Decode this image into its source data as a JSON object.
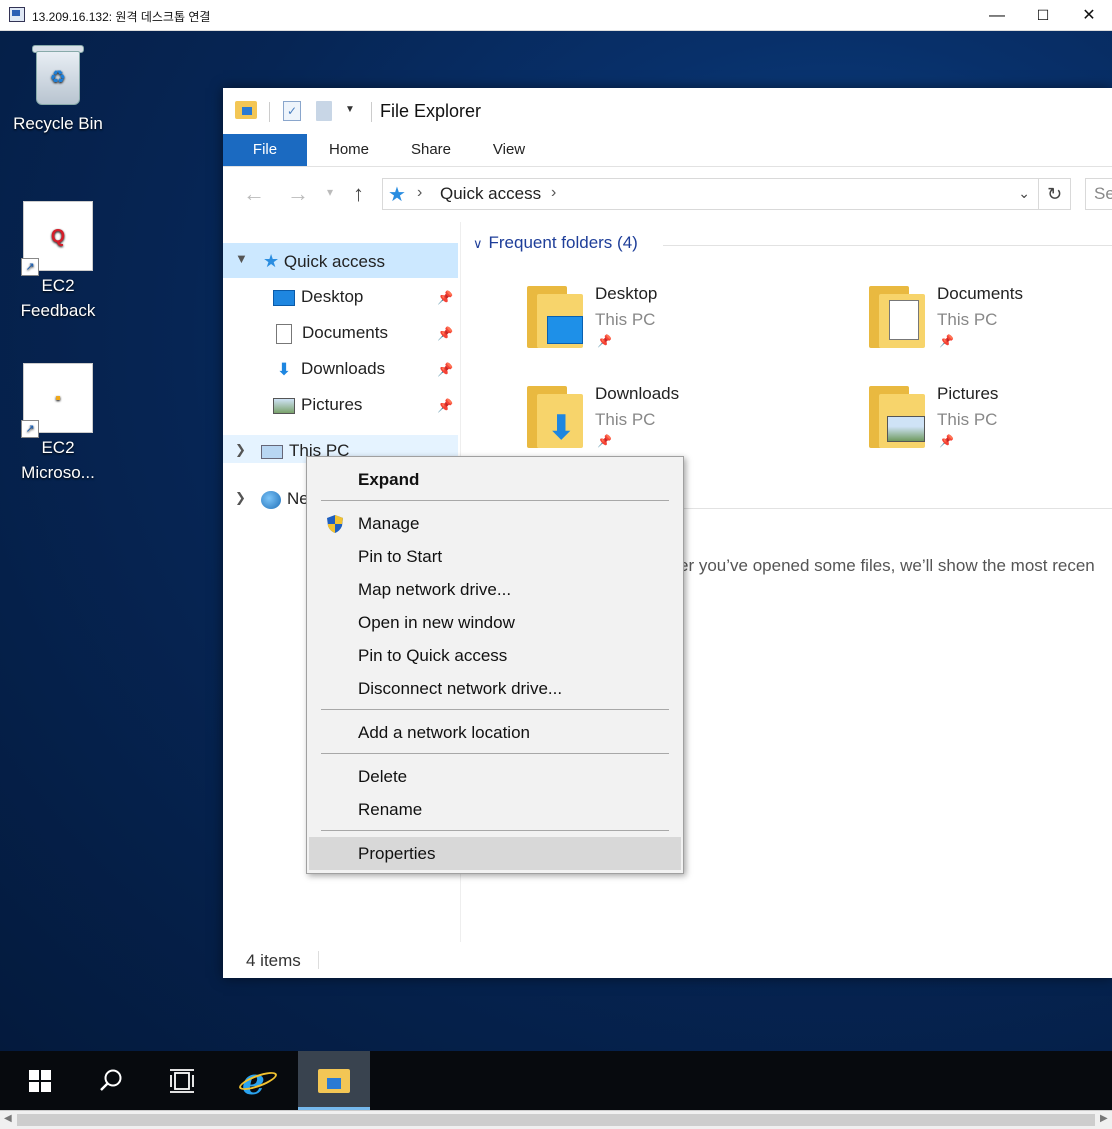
{
  "rdp": {
    "title": "13.209.16.132: 원격 데스크톱 연결",
    "min_glyph": "—",
    "max_glyph": "☐",
    "close_glyph": "✕"
  },
  "desktop": {
    "icons": [
      {
        "label": "Recycle Bin",
        "icon": "recycle-bin-icon"
      },
      {
        "label": "EC2\nFeedback",
        "line1": "EC2",
        "line2": "Feedback",
        "glyph": "Q",
        "icon": "ec2-feedback-icon"
      },
      {
        "label": "EC2 Microso...",
        "line1": "EC2",
        "line2": "Microso...",
        "glyph": "▪",
        "icon": "ec2-microsoft-icon"
      }
    ]
  },
  "explorer": {
    "title": "File Explorer",
    "ribbon_tabs": [
      "File",
      "Home",
      "Share",
      "View"
    ],
    "address": {
      "crumb": "Quick access",
      "search_placeholder": "Se"
    },
    "nav": {
      "quick_access": "Quick access",
      "items": [
        {
          "label": "Desktop",
          "icon": "desktop-icon"
        },
        {
          "label": "Documents",
          "icon": "documents-icon"
        },
        {
          "label": "Downloads",
          "icon": "downloads-icon"
        },
        {
          "label": "Pictures",
          "icon": "pictures-icon"
        }
      ],
      "this_pc": "This PC",
      "network": "Ne"
    },
    "frequent_header": "Frequent folders (4)",
    "folders": [
      {
        "name": "Desktop",
        "location": "This PC"
      },
      {
        "name": "Documents",
        "location": "This PC"
      },
      {
        "name": "Downloads",
        "location": "This PC"
      },
      {
        "name": "Pictures",
        "location": "This PC"
      }
    ],
    "recent_message": "er you’ve opened some files, we’ll show the most recen",
    "status": "4 items"
  },
  "context_menu": {
    "items": [
      "Expand",
      "Manage",
      "Pin to Start",
      "Map network drive...",
      "Open in new window",
      "Pin to Quick access",
      "Disconnect network drive...",
      "Add a network location",
      "Delete",
      "Rename",
      "Properties"
    ],
    "highlighted": "Properties"
  },
  "taskbar": {
    "buttons": [
      "start-button",
      "search-button",
      "task-view-button",
      "internet-explorer-button",
      "file-explorer-button"
    ],
    "active": "file-explorer-button"
  },
  "colors": {
    "accent": "#1b6ac1",
    "selection": "#cce8ff",
    "taskbar": "#070a0e"
  }
}
